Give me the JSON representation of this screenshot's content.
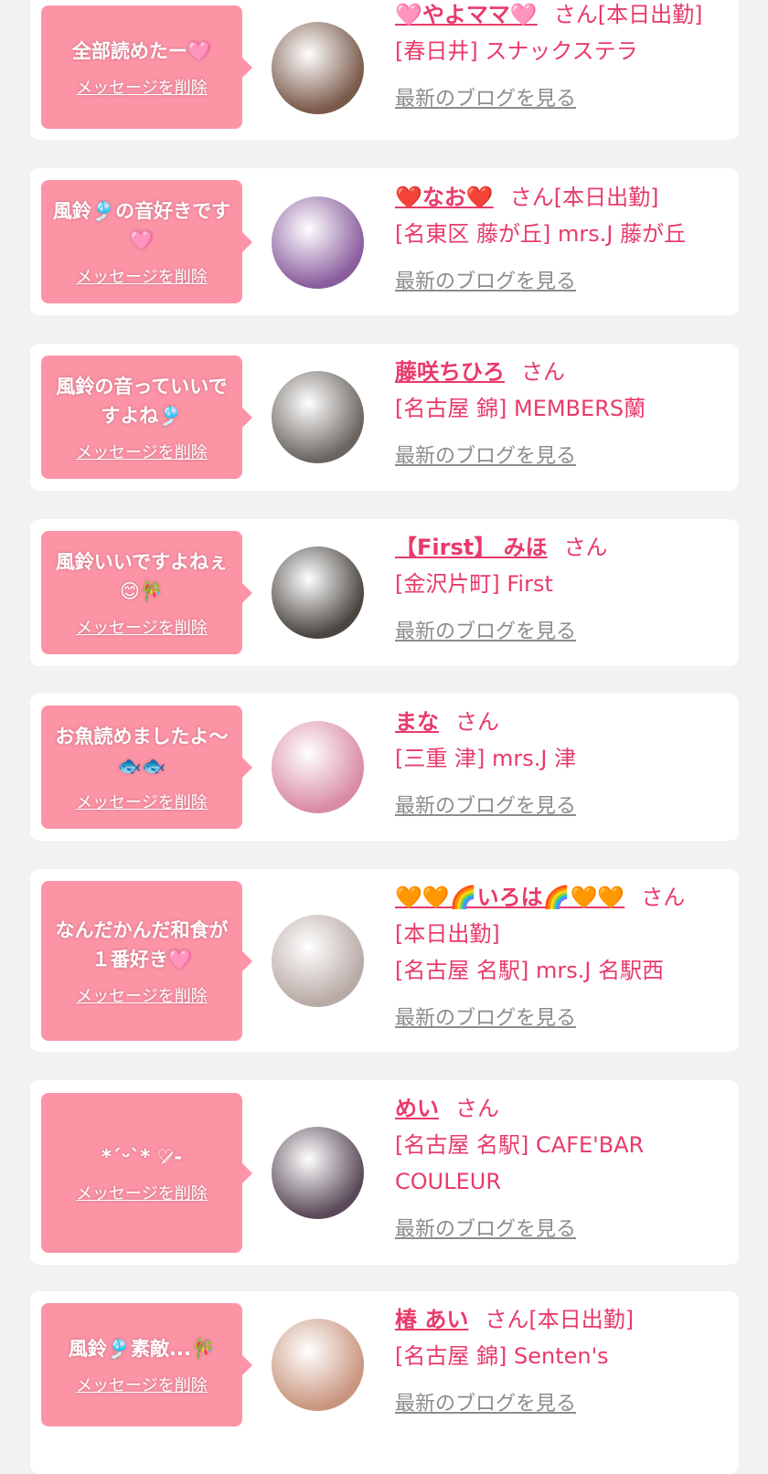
{
  "colors": {
    "accent": "#e83b6a",
    "bubble": "#fc94a6",
    "link_gray": "#8c8c8c",
    "page_bg": "#f2f2f2"
  },
  "labels": {
    "delete": "メッセージを削除",
    "blog": "最新のブログを見る"
  },
  "cards": [
    {
      "message": "全部読めたー🩷",
      "name": "🩷やよママ🩷",
      "suffix": "さん[本日出勤]",
      "shop_lines": [
        "[春日井] スナックステラ"
      ],
      "avatar_icon": "woman-with-flowers-photo",
      "avatar_color": "#7a5a4a"
    },
    {
      "message": "風鈴🎐の音好きです🩷",
      "name": "❤️なお❤️",
      "suffix": "さん[本日出勤]",
      "shop_lines": [
        "[名東区 藤が丘] mrs.J 藤が丘"
      ],
      "avatar_icon": "woman-purple-flowers-photo",
      "avatar_color": "#8a5d9e"
    },
    {
      "message": "風鈴の音っていいですよね🎐",
      "name": "藤咲ちひろ",
      "suffix": "さん",
      "shop_lines": [
        "[名古屋 錦] MEMBERS蘭"
      ],
      "avatar_icon": "hair-close-up-photo",
      "avatar_color": "#6b6560"
    },
    {
      "message": "風鈴いいですよねぇ😊🎋",
      "name": "【First】 みほ",
      "suffix": "さん",
      "shop_lines": [
        "[金沢片町] First"
      ],
      "avatar_icon": "curly-hair-photo",
      "avatar_color": "#4a4540"
    },
    {
      "message": "お魚読めましたよ〜🐟🐟",
      "name": "まな",
      "suffix": "さん",
      "shop_lines": [
        "[三重 津] mrs.J 津"
      ],
      "avatar_icon": "pink-scribble-photo",
      "avatar_color": "#d98ba5"
    },
    {
      "message": "なんだかんだ和食が１番好き🩷",
      "name": "🧡🧡🌈いろは🌈🧡🧡",
      "suffix": "さん",
      "shop_lines": [
        "[本日出勤]",
        "[名古屋 名駅] mrs.J 名駅西"
      ],
      "avatar_icon": "woman-heart-sticker-photo",
      "avatar_color": "#b8aaa5"
    },
    {
      "message": "*´ᵕ`* ♡̷-",
      "name": "めい",
      "suffix": "さん",
      "shop_lines": [
        "[名古屋 名駅] CAFE'BAR",
        "COULEUR"
      ],
      "avatar_icon": "white-heart-photo",
      "avatar_color": "#5a4a58"
    },
    {
      "message": "風鈴🎐素敵...🎋",
      "name": "椿 あい",
      "suffix": "さん[本日出勤]",
      "shop_lines": [
        "[名古屋 錦] Senten's"
      ],
      "avatar_icon": "smiling-woman-photo",
      "avatar_color": "#c9957e"
    }
  ]
}
